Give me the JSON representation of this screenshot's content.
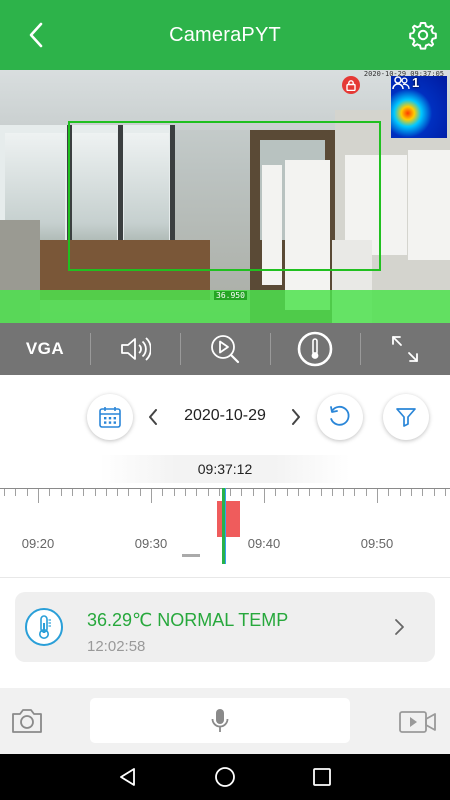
{
  "header": {
    "title": "CameraPYT",
    "back_icon": "chevron-left-icon",
    "settings_icon": "gear-icon",
    "color": "#2db34a"
  },
  "camera": {
    "timestamp": "2020-10-29 09:37:05",
    "face_temp_tag": "36.950",
    "people_count": "1",
    "lock_icon": "lock-icon",
    "detection_box_color": "#20c020"
  },
  "controls": {
    "resolution_label": "VGA",
    "items": [
      "resolution",
      "speaker-icon",
      "playback-search-icon",
      "thermometer-icon",
      "fullscreen-icon"
    ]
  },
  "date_bar": {
    "date": "2020-10-29",
    "calendar_icon": "calendar-icon",
    "refresh_icon": "refresh-icon",
    "filter_icon": "filter-icon"
  },
  "timeline": {
    "current_time": "09:37:12",
    "labels": [
      "09:20",
      "09:30",
      "09:40",
      "09:50"
    ],
    "record_color": "#ef5c5c",
    "playhead_color": "#28b24a"
  },
  "event": {
    "title": "36.29℃ NORMAL TEMP",
    "time": "12:02:58",
    "icon": "thermometer-icon",
    "title_color": "#27a83c"
  },
  "bottom_bar": {
    "snapshot_icon": "camera-icon",
    "mic_icon": "microphone-icon",
    "record_icon": "video-record-icon"
  },
  "system_nav": {
    "items": [
      "back-triangle-icon",
      "home-circle-icon",
      "recents-square-icon"
    ]
  }
}
